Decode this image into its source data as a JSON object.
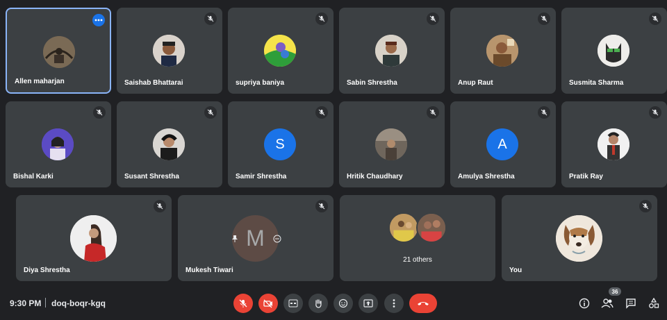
{
  "participants": [
    {
      "name": "Allen maharjan"
    },
    {
      "name": "Saishab Bhattarai"
    },
    {
      "name": "supriya baniya"
    },
    {
      "name": "Sabin Shrestha"
    },
    {
      "name": "Anup Raut"
    },
    {
      "name": "Susmita Sharma"
    },
    {
      "name": "Bishal Karki"
    },
    {
      "name": "Susant Shrestha"
    },
    {
      "name": "Samir Shrestha",
      "initial": "S"
    },
    {
      "name": "Hritik Chaudhary"
    },
    {
      "name": "Amulya Shrestha",
      "initial": "A"
    },
    {
      "name": "Pratik Ray"
    },
    {
      "name": "Diya Shrestha"
    },
    {
      "name": "Mukesh Tiwari",
      "initial": "M"
    },
    {
      "name": "You"
    }
  ],
  "others": {
    "label": "21 others"
  },
  "colors": {
    "accent": "#1a73e8",
    "samir": "#1a73e8",
    "amulya": "#1a73e8",
    "mukesh": "#795548",
    "danger": "#ea4335",
    "tile": "#3c4043",
    "background": "#202124"
  },
  "toolbar": {
    "time": "9:30 PM",
    "meeting_code": "doq-boqr-kgq",
    "participant_count": "36"
  }
}
